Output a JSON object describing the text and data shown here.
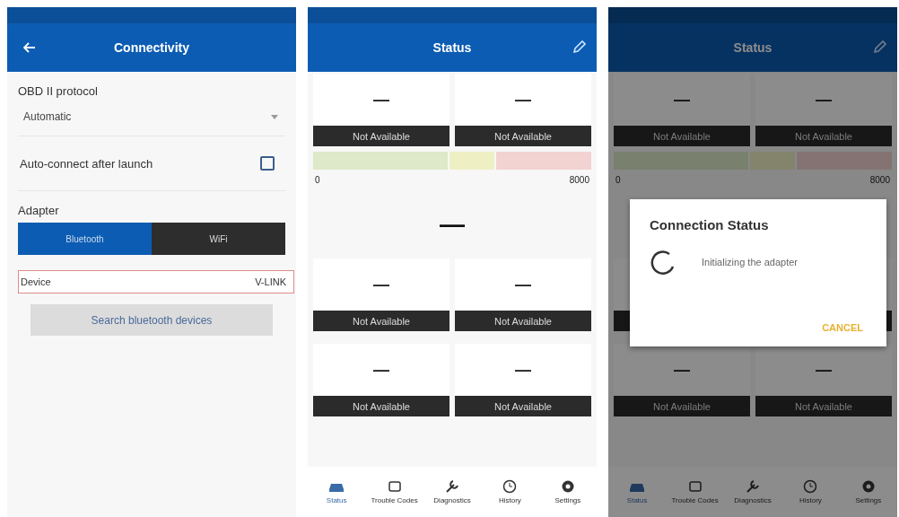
{
  "connectivity": {
    "title": "Connectivity",
    "protocol_label": "OBD II protocol",
    "protocol_value": "Automatic",
    "autoconnect_label": "Auto-connect after launch",
    "autoconnect_checked": false,
    "adapter_label": "Adapter",
    "adapter_tabs": [
      {
        "label": "Bluetooth",
        "selected": true
      },
      {
        "label": "WiFi",
        "selected": false
      }
    ],
    "device_label": "Device",
    "device_value": "V-LINK",
    "search_button": "Search bluetooth devices"
  },
  "status_screens": [
    {
      "title": "Status",
      "dimmed": false,
      "tiles": [
        {
          "value": "—",
          "status": "Not Available"
        },
        {
          "value": "—",
          "status": "Not Available"
        },
        {
          "value": "—",
          "status": "Not Available"
        },
        {
          "value": "—",
          "status": "Not Available"
        },
        {
          "value": "—",
          "status": "Not Available"
        },
        {
          "value": "—",
          "status": "Not Available"
        }
      ],
      "gauge": {
        "min_label": "0",
        "max_label": "8000",
        "value": "—"
      },
      "tabs": [
        {
          "label": "Status",
          "selected": true
        },
        {
          "label": "Trouble Codes",
          "selected": false
        },
        {
          "label": "Diagnostics",
          "selected": false
        },
        {
          "label": "History",
          "selected": false
        },
        {
          "label": "Settings",
          "selected": false
        }
      ]
    },
    {
      "title": "Status",
      "dimmed": true,
      "tiles": [
        {
          "value": "—",
          "status": "Not Available"
        },
        {
          "value": "—",
          "status": "Not Available"
        },
        {
          "value": "—",
          "status": "Not Available"
        },
        {
          "value": "—",
          "status": "Not Available"
        }
      ],
      "gauge": {
        "min_label": "0",
        "max_label": "8000"
      },
      "tabs": [
        {
          "label": "Status",
          "selected": true
        },
        {
          "label": "Trouble Codes",
          "selected": false
        },
        {
          "label": "Diagnostics",
          "selected": false
        },
        {
          "label": "History",
          "selected": false
        },
        {
          "label": "Settings",
          "selected": false
        }
      ],
      "dialog": {
        "title": "Connection Status",
        "message": "Initializing the adapter",
        "button": "CANCEL"
      }
    }
  ]
}
